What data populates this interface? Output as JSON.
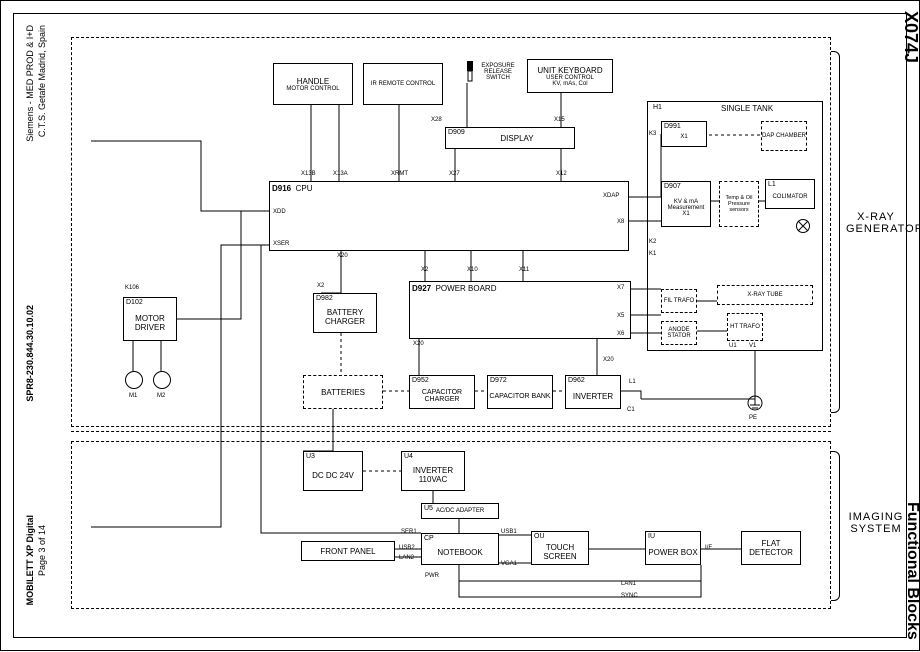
{
  "doc": {
    "code": "X074J",
    "section_title": "Functional Blocks",
    "company": "Siemens - MED PROD & I+D",
    "location": "C.T.S. Getafe   Madrid, Spain",
    "spr": "SPR8-230.844.30.10.02",
    "model": "MOBILETT XP Digital",
    "page": "Page 3 of 14"
  },
  "regions": {
    "xray": "X-RAY\nGENERATOR",
    "imaging": "IMAGING\nSYSTEM"
  },
  "blocks": {
    "motor_driver": {
      "id": "D102",
      "name": "MOTOR\nDRIVER"
    },
    "m1": "M1",
    "m2": "M2",
    "k106": "K106",
    "handle": {
      "name": "HANDLE",
      "sub": "MOTOR CONTROL"
    },
    "ir_remote": "IR REMOTE CONTROL",
    "exposure": {
      "name": "EXPOSURE\nRELEASE\nSWITCH"
    },
    "unit_kb": {
      "name": "UNIT KEYBOARD",
      "sub": "USER CONTROL\nKV, mAs, Col"
    },
    "display": "DISPLAY",
    "display_id": "D909",
    "cpu": {
      "id": "D916",
      "name": "CPU"
    },
    "xdd": "XDD",
    "xser": "XSER",
    "x13b": "X13B",
    "x13a": "X13A",
    "xrmt": "XRMT",
    "x27": "X27",
    "x12": "X12",
    "xdap": "XDAP",
    "x8": "X8",
    "x28": "X28",
    "x15": "X15",
    "x20": "X20",
    "x2": "X2",
    "x10": "X10",
    "x11": "X11",
    "single_tank": "SINGLE TANK",
    "h1": "H1",
    "dap": "DAP\nCHAMBER",
    "d991": "D991",
    "x1": "X1",
    "k3": "K3",
    "l1": "L1",
    "colimator": "COLIMATOR",
    "d907": {
      "id": "D907",
      "name": "KV & mA\nMeasurement"
    },
    "temp": "Temp\n&\nOil Pressure\nsensors",
    "k2": "K2",
    "k1": "K1",
    "power_board": {
      "id": "D927",
      "name": "POWER BOARD"
    },
    "x7": "X7",
    "x5": "X5",
    "x6": "X6",
    "battery_charger": {
      "id": "D982",
      "name": "BATTERY\nCHARGER"
    },
    "batteries": "BATTERIES",
    "cap_charger": {
      "id": "D952",
      "name": "CAPACITOR\nCHARGER"
    },
    "cap_bank": {
      "id": "D972",
      "name": "CAPACITOR\nBANK"
    },
    "inverter": {
      "id": "D962",
      "name": "INVERTER"
    },
    "fil": "FIL\nTRAFO",
    "xray_tube": "X-RAY TUBE",
    "anode": "ANODE\nSTATOR",
    "ht": "HT\nTRAFO",
    "u1": "U1",
    "v1": "V1",
    "c1": "C1",
    "pe": "PE",
    "l1s": "L1",
    "dcdc": {
      "id": "U3",
      "name": "DC DC\n24V"
    },
    "inv110": {
      "id": "U4",
      "name": "INVERTER\n110VAC"
    },
    "acdc": {
      "id": "U5",
      "name": "AC/DC ADAPTER"
    },
    "notebook": {
      "id": "CP",
      "name": "NOTEBOOK"
    },
    "touch": {
      "id": "OU",
      "name": "TOUCH\nSCREEN"
    },
    "powerbox": {
      "id": "IU",
      "name": "POWER\nBOX"
    },
    "flat": "FLAT\nDETECTOR",
    "front_panel": "FRONT PANEL",
    "ser1": "SER1",
    "usb1": "USB1",
    "usb2": "USB2",
    "lan2": "LAN2",
    "vga1": "VGA1",
    "pwr": "PWR",
    "lan1": "LAN1",
    "sync": "SYNC",
    "if": "I/F"
  }
}
